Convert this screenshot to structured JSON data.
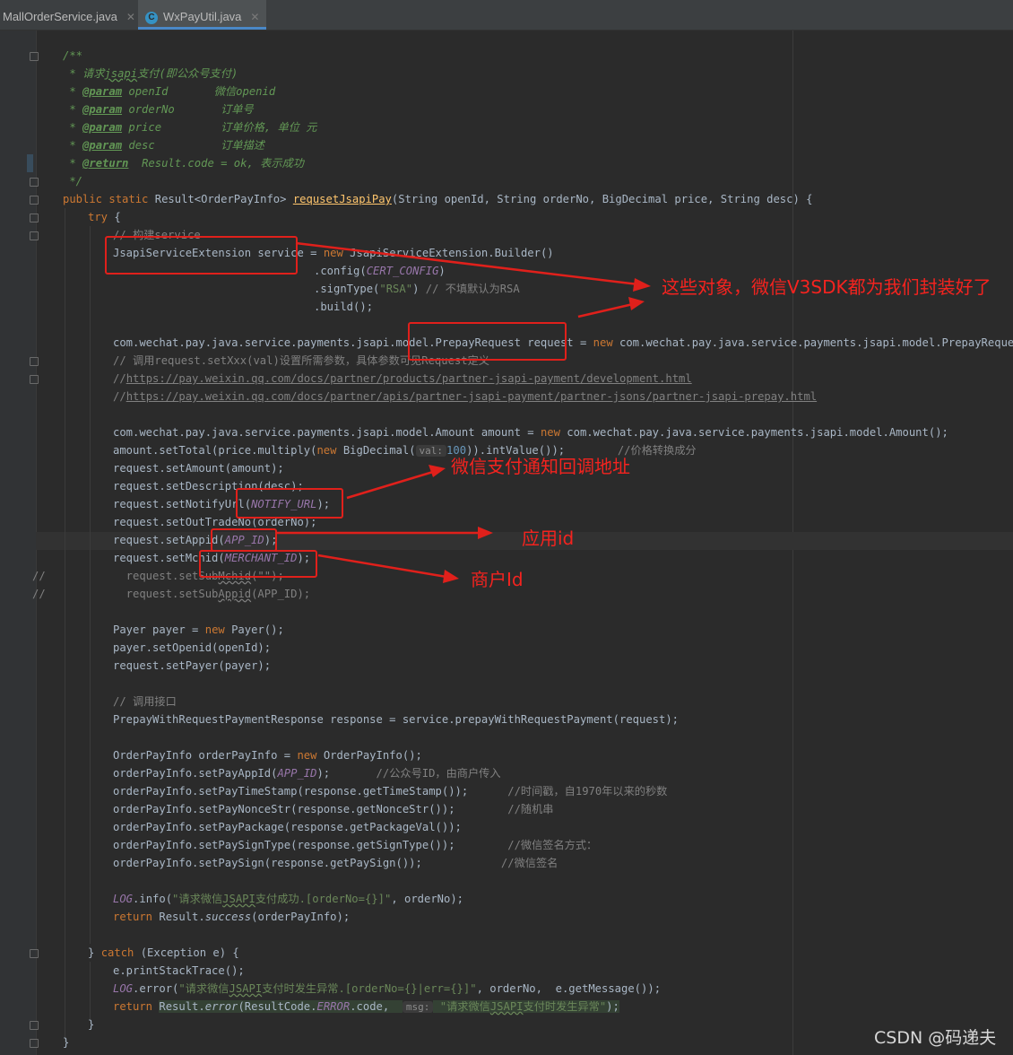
{
  "tabs": [
    {
      "label": "MallOrderService.java",
      "active": false
    },
    {
      "label": "WxPayUtil.java",
      "active": true,
      "icon": "C"
    }
  ],
  "code": {
    "l60": "/**",
    "l80a": " * 请求",
    "l80b": "jsapi",
    "l80c": "支付(即公众号支付)",
    "p1_tag": "@param",
    "p1_name": " openId",
    "p1_desc": "       微信openid",
    "p2_name": " orderNo",
    "p2_desc": "       订单号",
    "p3_name": " price",
    "p3_desc": "         订单价格, 单位 元",
    "p4_name": " desc",
    "p4_desc": "          订单描述",
    "ret_tag": "@return",
    "ret_desc": "  Result.code = ok, 表示成功",
    "l200": " */",
    "sig_kw": "public static ",
    "sig_type": "Result<OrderPayInfo> ",
    "sig_fn": "requsetJsapiPay",
    "sig_rest": "(String openId, String orderNo, BigDecimal price, String desc) {",
    "try_kw": "try",
    "brace_open": " {",
    "c260": "// 构建service",
    "l280a": "JsapiServiceExtension service = ",
    "new_kw": "new ",
    "l280b": "JsapiServiceExtension.Builder()",
    "l300a": ".config(",
    "cert_config": "CERT_CONFIG",
    "close_paren": ")",
    "l320a": ".signType(",
    "rsa": "\"RSA\"",
    "l320b": ") ",
    "c320": "// 不填默认为RSA",
    "l340": ".build();",
    "l380a": "com.wechat.pay.java.service.payments.jsapi.model.PrepayRequest request = ",
    "l380b": "com.wechat.pay.java.service.payments.jsapi.model.PrepayRequest();",
    "c400": "// 调用request.setXxx(val)设置所需参数，具体参数可见Request定义",
    "c420a": "//",
    "url1": "https://pay.weixin.qq.com/docs/partner/products/partner-jsapi-payment/development.html",
    "url2": "https://pay.weixin.qq.com/docs/partner/apis/partner-jsapi-payment/partner-jsons/partner-jsapi-prepay.html",
    "l480a": "com.wechat.pay.java.service.payments.jsapi.model.Amount amount = ",
    "l480b": "com.wechat.pay.java.service.payments.jsapi.model.Amount();",
    "l500a": "amount.setTotal(price.multiply(",
    "l500b": "BigDecimal(",
    "hint_val": "val:",
    "n100": "100",
    "l500c": ")).intValue());",
    "c500": "        //价格转换成分",
    "l520": "request.setAmount(amount);",
    "l540": "request.setDescription(desc);",
    "l560a": "request.setNotifyUrl(",
    "notify_url": "NOTIFY_URL",
    "stmt_end": ");",
    "l580": "request.setOutTradeNo(orderNo);",
    "l600a": "request.setAppid(",
    "app_id": "APP_ID",
    "l620a": "request.setMchid(",
    "merchant_id": "MERCHANT_ID",
    "g_comment": "//",
    "l640a": "  request.setSub",
    "l640b": "Mchid",
    "l640c": "(\"\");",
    "l660a": "  request.setSub",
    "l660b": "Appid",
    "l660c": "(APP_ID);",
    "l700a": "Payer payer = ",
    "l700b": "Payer();",
    "l720": "payer.setOpenid(openId);",
    "l740": "request.setPayer(payer);",
    "c780": "// 调用接口",
    "l800": "PrepayWithRequestPaymentResponse response = service.prepayWithRequestPayment(request);",
    "l840a": "OrderPayInfo orderPayInfo = ",
    "l840b": "OrderPayInfo();",
    "l860a": "orderPayInfo.setPayAppId(",
    "l860b": ");",
    "c860": "       //公众号ID，由商户传入",
    "l880": "orderPayInfo.setPayTimeStamp(response.getTimeStamp());",
    "c880": "      //时间戳，自1970年以来的秒数",
    "l900": "orderPayInfo.setPayNonceStr(response.getNonceStr());",
    "c900": "        //随机串",
    "l920": "orderPayInfo.setPayPackage(response.getPackageVal());",
    "l940": "orderPayInfo.setPaySignType(response.getSignType());",
    "c940": "        //微信签名方式：",
    "l960": "orderPayInfo.setPaySign(response.getPaySign());",
    "c960": "            //微信签名",
    "log": "LOG",
    "l1000a": ".info(",
    "s1000a": "\"请求微信",
    "s_jsapi": "JSAPI",
    "s1000b": "支付成功.[orderNo={}]\"",
    "l1000b": ", orderNo);",
    "return_kw": "return ",
    "l1020a": "Result.",
    "success": "success",
    "l1020b": "(orderPayInfo);",
    "l1060a": "} ",
    "catch_kw": "catch",
    "l1060b": " (Exception e) {",
    "l1080": "e.printStackTrace();",
    "l1100a": ".error(",
    "s1100a": "\"请求微信",
    "s1100b": "支付时发生异常.[orderNo={}|err={}]\"",
    "l1100b": ", orderNo,  e.getMessage());",
    "l1120a": "Result.",
    "error": "error",
    "l1120b": "(ResultCode.",
    "error_const": "ERROR",
    "l1120c": ".code,  ",
    "hint_msg": "msg:",
    "s1120a": "\"请求微信",
    "s1120b": "支付时发生异常\"",
    "brace_close": "}"
  },
  "annotations": {
    "objects": "这些对象，微信V3SDK都为我们封装好了",
    "notify": "微信支付通知回调地址",
    "appid": "应用id",
    "mchid": "商户Id"
  },
  "watermark": "CSDN @码递夫",
  "colors": {
    "background": "#2b2b2b",
    "keyword": "#cc7832",
    "string": "#6a8759",
    "constant": "#9876aa",
    "javadoc": "#629755",
    "annotation_red": "#e0201b"
  }
}
